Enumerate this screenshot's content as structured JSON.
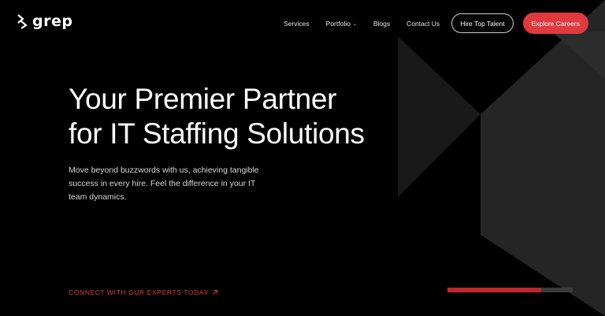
{
  "brand": {
    "name": "grep"
  },
  "nav": {
    "items": [
      {
        "label": "Services"
      },
      {
        "label": "Portfolio",
        "has_dropdown": true
      },
      {
        "label": "Blogs"
      },
      {
        "label": "Contact Us"
      }
    ],
    "hire_button": "Hire Top Talent",
    "careers_button": "Explore Careers"
  },
  "hero": {
    "title_line1": "Your Premier Partner",
    "title_line2": "for IT Staffing Solutions",
    "subtitle": "Move beyond buzzwords with us, achieving tangible success in every hire. Feel the difference in your IT team dynamics.",
    "cta": "CONNECT WITH OUR EXPERTS TODAY",
    "cta_icon": "arrow-up-right-icon"
  },
  "slider": {
    "progress": 0.75
  },
  "colors": {
    "accent": "#e03a3e",
    "background": "#000000"
  }
}
